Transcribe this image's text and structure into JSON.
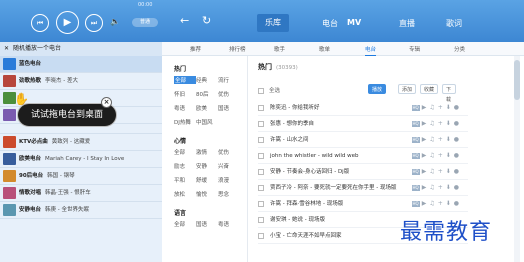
{
  "player": {
    "time": "00:00",
    "quality_label": "普通",
    "icons": {
      "prev": "prev-icon",
      "play": "play-icon",
      "next": "next-icon",
      "volume": "volume-icon"
    }
  },
  "radio_list": {
    "header": "随机播放一个电台",
    "items": [
      {
        "name": "蓝色电台",
        "song": "",
        "thumb": "#2a7bd9"
      },
      {
        "name": "劲歌热歌",
        "song": "李晓杰 - 差大",
        "thumb": "#b7463c"
      },
      {
        "name": "",
        "song": "",
        "thumb": "#4b8f3c"
      },
      {
        "name": "",
        "song": "",
        "thumb": "#7a5bb0"
      },
      {
        "name": "KTV必点曲",
        "song": "黄致列 - 这藏爱",
        "thumb": "#cc4b2d"
      },
      {
        "name": "欧美电台",
        "song": "Mariah Carey - I Stay In Love",
        "thumb": "#375d9c"
      },
      {
        "name": "90后电台",
        "song": "韩国 - 钢琴",
        "thumb": "#d38b2e"
      },
      {
        "name": "情歌对唱",
        "song": "韩晶·王强 - 恨肝车",
        "thumb": "#b8507a"
      },
      {
        "name": "安静电台",
        "song": "韩庚 - 全世界失眠",
        "thumb": "#5b97b0"
      }
    ]
  },
  "tooltip": {
    "text": "试试拖电台到桌面",
    "close": "×"
  },
  "topnav": {
    "tabs": [
      "乐库",
      "电台",
      "MV",
      "直播",
      "歌词"
    ]
  },
  "subnav": {
    "tabs": [
      "推荐",
      "排行榜",
      "歌手",
      "歌单",
      "电台",
      "专辑",
      "分类"
    ]
  },
  "categories": {
    "groups": [
      {
        "title": "热门",
        "items": [
          "全部",
          "经典",
          "流行",
          "怀旧",
          "80后",
          "优伤",
          "粤语",
          "欧美",
          "国语",
          "DJ热舞",
          "中国风",
          ""
        ]
      },
      {
        "title": "心情",
        "items": [
          "全部",
          "激情",
          "优伤",
          "励志",
          "安静",
          "兴奋",
          "平和",
          "舒缓",
          "浪漫",
          "放松",
          "愉悦",
          "思念"
        ]
      },
      {
        "title": "语言",
        "items": [
          "全部",
          "国语",
          "粤语",
          "",
          "",
          ""
        ]
      }
    ]
  },
  "list": {
    "title": "热门",
    "count": "(30393)",
    "select_all": "全选",
    "buttons": [
      "播放",
      "添加",
      "收藏",
      "下载"
    ],
    "songs": [
      "陈奕迅 - 你给我听好",
      "张惠 - 想你的季自",
      "许嵩 - 山水之间",
      "john the whistler - wild wild web",
      "安静 - 节奏会-身心话回归 - Dj版",
      "贾西子冷 - 阿奈 - 要死就一定要死在你手里 - 现场版",
      "许嵩 - 拜森·雪谷林地 - 现场版",
      "谢安琪 - 她说 - 现场版",
      "小宝 - 亡命天涯不如早点回家"
    ]
  },
  "watermark": "最需教育"
}
